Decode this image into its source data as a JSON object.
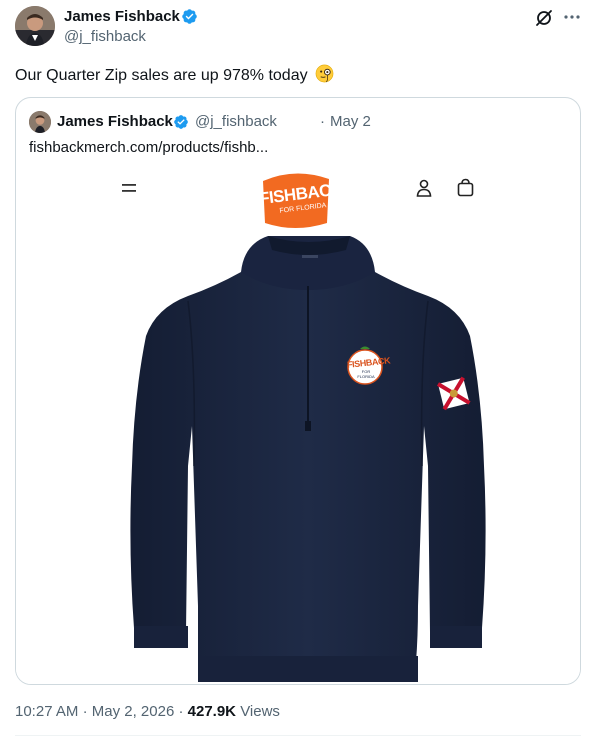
{
  "author": {
    "name": "James Fishback",
    "handle": "@j_fishback",
    "verified": true
  },
  "tweet": {
    "text": "Our Quarter Zip sales are up 978% today",
    "emoji": "monocle-face"
  },
  "quoted": {
    "name": "James Fishback",
    "handle": "@j_fishback",
    "separator": "·",
    "date": "May 2",
    "link": "fishbackmerch.com/products/fishb..."
  },
  "product": {
    "logo_text": "FISHBACK",
    "logo_sub": "FOR FLORIDA",
    "badge_text": "FISHBACK",
    "badge_sub": "FOR FLORIDA",
    "garment_color": "#1c2740",
    "logo_color": "#f26a21"
  },
  "footer": {
    "time": "10:27 AM",
    "sep1": "·",
    "date": "May 2, 2026",
    "sep2": "·",
    "views_count": "427.9K",
    "views_label": "Views"
  },
  "colors": {
    "verified_blue": "#1d9bf0",
    "secondary_text": "#536471",
    "primary_text": "#0f1419",
    "border": "#cfd9de"
  },
  "icons": [
    "verified-badge-icon",
    "grok-icon",
    "more-icon",
    "monocle-face-icon",
    "hamburger-menu-icon",
    "account-icon",
    "shopping-bag-icon"
  ]
}
